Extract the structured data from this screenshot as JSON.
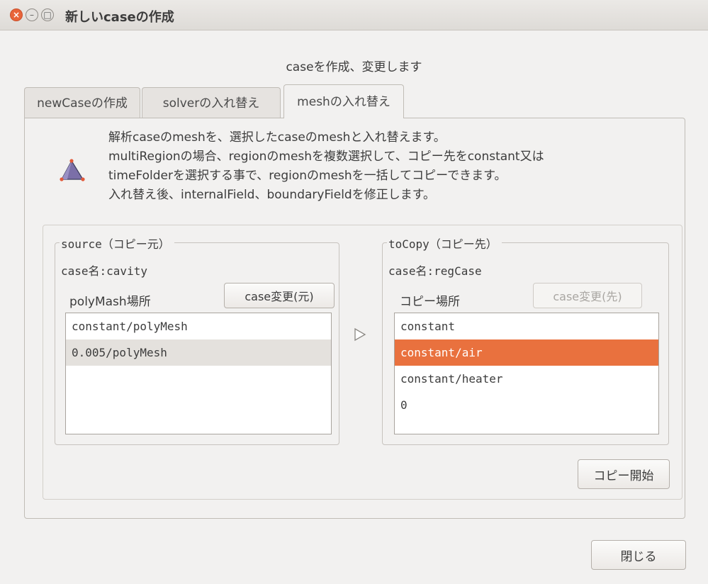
{
  "window": {
    "title": "新しいcaseの作成",
    "close": "×",
    "minimize": "–",
    "maximize": "□"
  },
  "subtitle": "caseを作成、変更します",
  "tabs": [
    {
      "label": "newCaseの作成"
    },
    {
      "label": "solverの入れ替え"
    },
    {
      "label": "meshの入れ替え"
    }
  ],
  "description": [
    "解析caseのmeshを、選択したcaseのmeshと入れ替えます。",
    "multiRegionの場合、regionのmeshを複数選択して、コピー先をconstant又は",
    "timeFolderを選択する事で、regionのmeshを一括してコピーできます。",
    "入れ替え後、internalField、boundaryFieldを修正します。"
  ],
  "source": {
    "title": "source（コピー元）",
    "case_name": "case名:cavity",
    "location_label": "polyMash場所",
    "change_button": "case変更(元)",
    "items": [
      "constant/polyMesh",
      "0.005/polyMesh"
    ],
    "selected_index": 1
  },
  "target": {
    "title": "toCopy（コピー先）",
    "case_name": "case名:regCase",
    "location_label": "コピー場所",
    "change_button": "case変更(先)",
    "items": [
      "constant",
      "constant/air",
      "constant/heater",
      "0"
    ],
    "selected_index": 1
  },
  "copy_button": "コピー開始",
  "close_button": "閉じる",
  "colors": {
    "selection": "#e9713e",
    "source_selection": "#e4e1dd",
    "close_button": "#e8643a"
  }
}
